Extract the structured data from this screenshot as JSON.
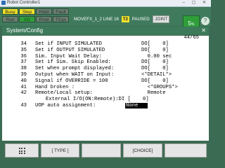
{
  "window": {
    "title": "Robot Controller1"
  },
  "status": {
    "leds_top": [
      "Busy",
      "Step",
      "Hold",
      "Fault"
    ],
    "leds_bottom": [
      "Run",
      "I/O",
      "Prod",
      "TCyc"
    ],
    "program": "MOVEFX_1_2 LINE 16",
    "mode": "T2",
    "state": "PAUSED",
    "coord": "JOINT",
    "override": "5",
    "override_unit": "%",
    "help": "?"
  },
  "screen": {
    "title": "System/Config",
    "close": "✕",
    "pager": "44/65"
  },
  "config_rows": [
    {
      "num": "34",
      "label": "Set if INPUT SIMULATED",
      "value": "DO[    0]"
    },
    {
      "num": "35",
      "label": "Set if OUTPUT SIMULATED",
      "value": "DO[    0]"
    },
    {
      "num": "36",
      "label": "Sim. Input Wait Delay:",
      "value": "  0.00 sec"
    },
    {
      "num": "37",
      "label": "Set if Sim. Skip Enabled:",
      "value": "DO[    0]"
    },
    {
      "num": "38",
      "label": "Set when prompt displayed:",
      "value": "DO[    0]"
    },
    {
      "num": "39",
      "label": "Output when WAIT on Input:",
      "value": "<*DETAIL*>"
    },
    {
      "num": "40",
      "label": "Signal if OVERRIDE = 100",
      "value": "DO[    0]"
    },
    {
      "num": "41",
      "label": "Hand broken :",
      "value": "  <*GROUPS*>"
    },
    {
      "num": "42",
      "label": "Remote/Local setup:",
      "value": "  Remote"
    },
    {
      "num": "",
      "label": "External I/O(ON:Remote):DI [    0]",
      "value": ""
    },
    {
      "num": "43",
      "label": "UOP auto assignment:",
      "value": "None"
    }
  ],
  "function_keys": [
    "",
    "[ TYPE ]",
    "",
    "[CHOICE]",
    ""
  ]
}
